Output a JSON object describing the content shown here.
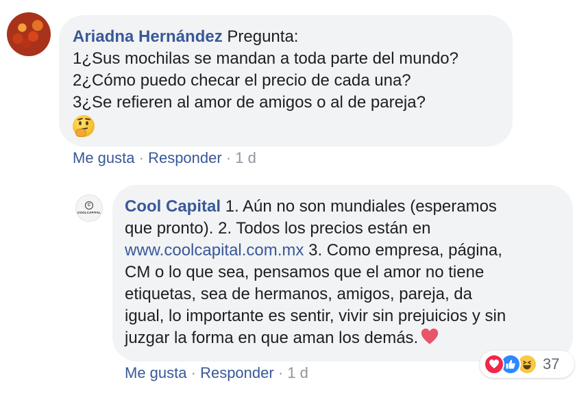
{
  "comment": {
    "author": "Ariadna Hernández",
    "lines": [
      "Pregunta:",
      "1¿Sus mochilas se mandan a toda parte del mundo?",
      "2¿Cómo puedo checar el precio de cada una?",
      "3¿Se refieren al amor de amigos o al de pareja?"
    ],
    "emoji": "thinking-face-icon",
    "actions": {
      "like": "Me gusta",
      "reply": "Responder",
      "separator": "·",
      "time": "1 d"
    }
  },
  "reply": {
    "author": "Cool Capital",
    "avatar_text": "COOLCAPITAL",
    "line1": "1. Aún no son mundiales (esperamos",
    "line2": "que pronto). 2. Todos los precios están en",
    "link": "www.coolcapital.com.mx",
    "line3_after_link": " 3. Como empresa, página,",
    "line4": "CM o lo que sea, pensamos que el amor no tiene",
    "line5": "etiquetas, sea de hermanos, amigos, pareja, da",
    "line6": "igual, lo importante es sentir, vivir sin prejuicios y sin",
    "line7": "juzgar la forma en que aman los demás.",
    "emoji": "heart-icon",
    "actions": {
      "like": "Me gusta",
      "reply": "Responder",
      "separator": "·",
      "time": "1 d"
    },
    "reactions": {
      "types": [
        "love-icon",
        "like-icon",
        "haha-icon"
      ],
      "count": "37"
    }
  },
  "colors": {
    "link": "#385898",
    "bubble": "#f2f3f5",
    "meta": "#90949c"
  }
}
